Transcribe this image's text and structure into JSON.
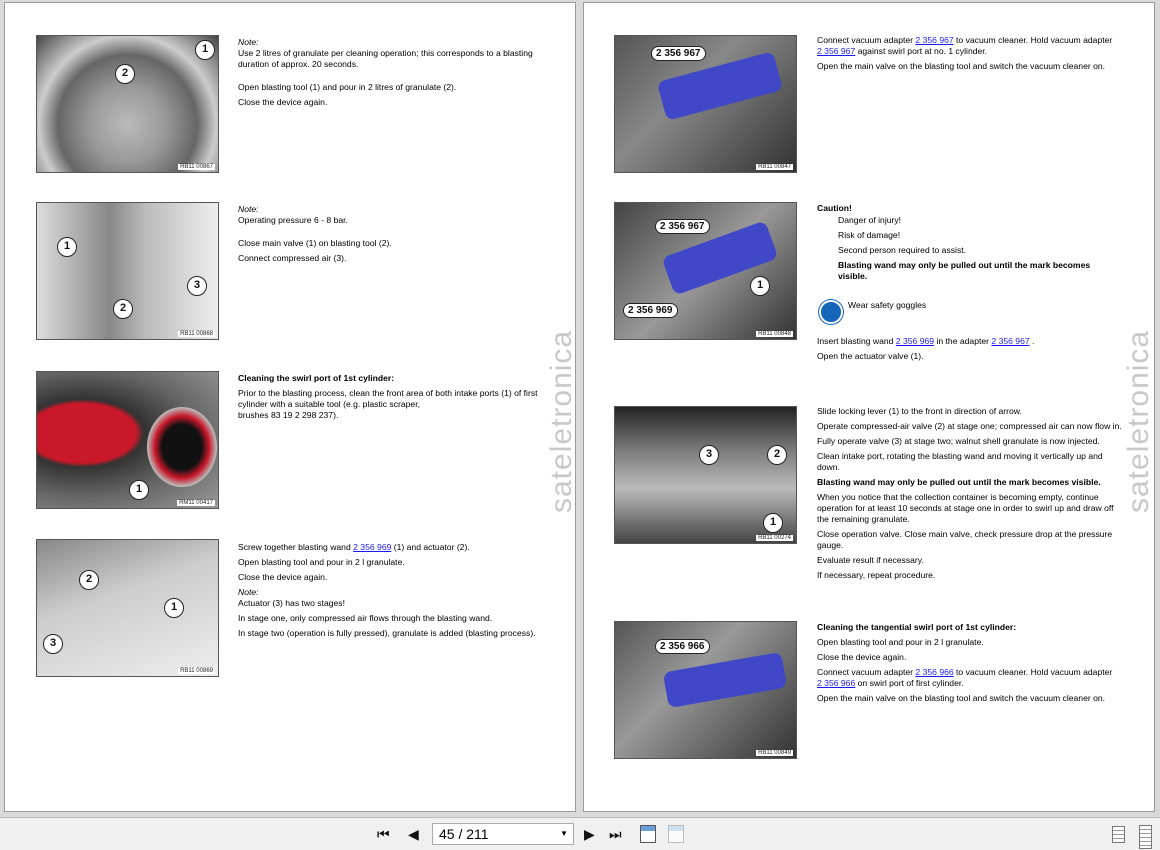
{
  "watermark": "sateletronica",
  "left_page": {
    "figures": [
      {
        "code": "RB11 00867",
        "callouts": [
          "1",
          "2"
        ]
      },
      {
        "code": "RB11 00868",
        "callouts": [
          "1",
          "2",
          "3"
        ]
      },
      {
        "code": "RM11 00417",
        "callouts": [
          "1"
        ]
      },
      {
        "code": "RB11 00869",
        "callouts": [
          "1",
          "2",
          "3"
        ]
      }
    ],
    "s1": {
      "note": "Note:",
      "note_text": "Use 2 litres of granulate per cleaning operation; this corresponds to a blasting duration of approx. 20 seconds.",
      "p1": "Open blasting tool (1) and pour in 2 litres of granulate (2).",
      "p2": "Close the device again."
    },
    "s2": {
      "note": "Note:",
      "note_text": "Operating pressure 6 - 8 bar.",
      "p1": "Close main valve (1) on blasting tool (2).",
      "p2": "Connect compressed air (3)."
    },
    "s3": {
      "heading": "Cleaning the swirl port of 1st cylinder:",
      "p1": "Prior to the blasting process, clean the front area of both intake ports (1) of first cylinder with a suitable tool (e.g. plastic scraper,",
      "p1b": "brushes 83 19 2 298 237)."
    },
    "s4": {
      "p1a": "Screw together blasting wand ",
      "link": "2 356 969",
      "p1b": "  (1) and actuator (2).",
      "p2": "Open blasting tool and pour in 2 l granulate.",
      "p3": "Close the device again.",
      "note": "Note:",
      "note_text": "Actuator (3) has two stages!",
      "p4": "In stage one, only compressed air flows through the blasting wand.",
      "p5": "In stage two (operation is fully pressed), granulate is added (blasting process)."
    }
  },
  "right_page": {
    "figures": [
      {
        "code": "RB11 00847",
        "tags": [
          "2 356 967"
        ]
      },
      {
        "code": "RB11 00848",
        "tags": [
          "2 356 967",
          "2 356 969"
        ],
        "callouts": [
          "1"
        ]
      },
      {
        "code": "RB11 00274",
        "callouts": [
          "3",
          "2",
          "1"
        ]
      },
      {
        "code": "RB11 00849",
        "tags": [
          "2 356 966"
        ]
      }
    ],
    "s1": {
      "a": "Connect vacuum adapter ",
      "l1": "2 356 967",
      "b": " to vacuum cleaner. Hold vacuum adapter ",
      "l2": "2 356 967",
      "c": " against swirl port at no. 1 cylinder.",
      "p2": "Open the main valve on the blasting tool and switch the vacuum cleaner on."
    },
    "s2": {
      "caution": "Caution!",
      "c1": "Danger of injury!",
      "c2": "Risk of damage!",
      "c3": "Second person required to assist.",
      "c4": "Blasting wand may only be pulled out until the mark becomes visible.",
      "goggles": "Wear safety goggles",
      "p1a": "Insert blasting wand ",
      "l1": "2 356 969",
      "p1b": " in the adapter ",
      "l2": "2 356 967",
      "p1c": " .",
      "p2": "Open the actuator valve (1)."
    },
    "s3": {
      "p1": "Slide locking lever (1) to the front in direction of arrow.",
      "p2": "Operate compressed-air valve (2) at stage one; compressed air can now flow in.",
      "p3": "Fully operate valve (3) at stage two; walnut shell granulate is now injected.",
      "p4": "Clean intake port, rotating the blasting wand and moving it vertically up and down.",
      "p5": "Blasting wand may only be pulled out until the mark becomes visible.",
      "p6": "When you notice that the collection container is becoming empty, continue operation for at least 10 seconds at stage one in order to swirl up and draw off the remaining granulate.",
      "p7": "Close operation valve. Close main valve, check pressure drop at the pressure gauge.",
      "p8": "Evaluate result if necessary.",
      "p9": "If necessary, repeat procedure."
    },
    "s4": {
      "heading": "Cleaning the tangential swirl port of 1st cylinder:",
      "p1": "Open blasting tool and pour in 2 l granulate.",
      "p2": "Close the device again.",
      "a": "Connect vacuum adapter ",
      "l1": "2 356 966",
      "b": " to vacuum cleaner. Hold vacuum adapter ",
      "l2": "2 356 966",
      "c": " on swirl port of first cylinder.",
      "p4": "Open the main valve on the blasting tool and switch the vacuum cleaner on."
    }
  },
  "toolbar": {
    "page_value": "45 / 211",
    "first": "⏮",
    "prev": "◀",
    "next": "▶",
    "last": "⏭"
  }
}
